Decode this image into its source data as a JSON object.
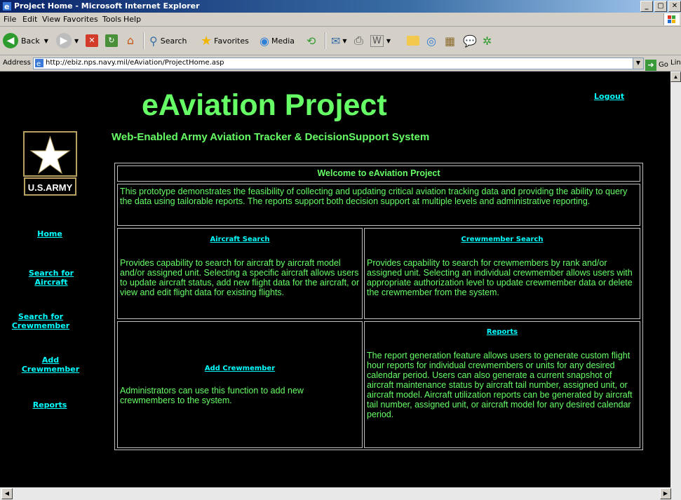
{
  "window": {
    "title": "Project Home - Microsoft Internet Explorer",
    "buttons": [
      "_",
      "▢",
      "✕"
    ]
  },
  "menu": [
    "File",
    "Edit",
    "View",
    "Favorites",
    "Tools",
    "Help"
  ],
  "toolbar": {
    "back_label": "Back",
    "search_label": "Search",
    "favorites_label": "Favorites",
    "media_label": "Media"
  },
  "address": {
    "label": "Address",
    "url": "http://ebiz.nps.navy.mil/eAviation/ProjectHome.asp",
    "go_label": "Go",
    "links_label": "Links"
  },
  "page": {
    "logout": "Logout",
    "title": "eAviation Project",
    "subtitle": "Web-Enabled Army Aviation Tracker & DecisionSupport System",
    "logo_text": "U.S.ARMY",
    "nav": {
      "home": "Home",
      "search_aircraft_1": "Search for",
      "search_aircraft_2": "Aircraft",
      "search_crew_1": "Search for",
      "search_crew_2": "Crewmember",
      "add_crew_1": "Add",
      "add_crew_2": "Crewmember",
      "reports": "Reports"
    },
    "welcome_heading": "Welcome to eAviation Project",
    "intro": "This prototype demonstrates the feasibility of collecting and updating critical aviation tracking data and providing the ability to query the data using tailorable reports. The reports support both decision support at multiple levels and administrative reporting.",
    "aircraft_search": {
      "link": "Aircraft Search",
      "text": "Provides capability to search for aircraft by aircraft model and/or assigned unit. Selecting a specific aircraft allows users to update aircraft status, add new flight data for the aircraft, or view and edit flight data for existing flights."
    },
    "crew_search": {
      "link": "Crewmember Search",
      "text": "Provides capability to search for crewmembers by rank and/or assigned unit. Selecting an individual crewmember allows users with appropriate authorization level to update crewmember data or delete the crewmember from the system."
    },
    "add_crew": {
      "link": "Add Crewmember",
      "text": "Administrators can use this function to add new crewmembers to the system."
    },
    "reports": {
      "link": "Reports",
      "text": "The report generation feature allows users to generate custom flight hour reports for individual crewmembers or units for any desired calendar period. Users can also generate a current snapshot of aircraft maintenance status by aircraft tail number, assigned unit, or aircraft model. Aircraft utilization reports can be generated by aircraft tail number, assigned unit, or aircraft model for any desired calendar period."
    }
  },
  "colors": {
    "page_bg": "#000000",
    "title_green": "#66ff66",
    "link_cyan": "#00ffff"
  }
}
